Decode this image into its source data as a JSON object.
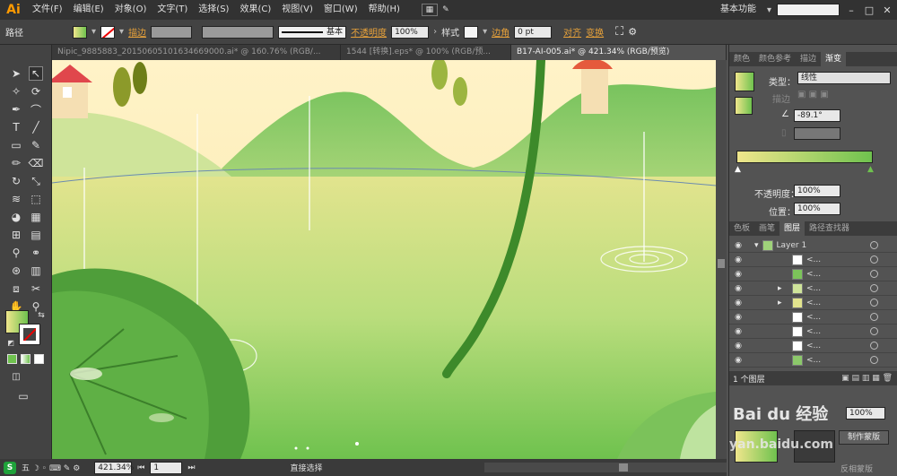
{
  "app": {
    "logo": "Ai"
  },
  "menubar": {
    "items": [
      "文件(F)",
      "编辑(E)",
      "对象(O)",
      "文字(T)",
      "选择(S)",
      "效果(C)",
      "视图(V)",
      "窗口(W)",
      "帮助(H)"
    ],
    "workspace": "基本功能",
    "window_controls": [
      "–",
      "□",
      "✕"
    ]
  },
  "control_bar": {
    "selection_label": "路径",
    "stroke_label": "描边",
    "stroke_style": "基本",
    "opacity_label": "不透明度",
    "opacity_value": "100%",
    "style_label": "样式",
    "corner_label": "边角",
    "corner_value": "0 pt",
    "align_label": "对齐",
    "transform_label": "变换"
  },
  "tabs": [
    {
      "label": "Nipic_9885883_20150605101634669000.ai* @ 160.76% (RGB/...",
      "active": false
    },
    {
      "label": "1544 [转换].eps* @ 100% (RGB/预...",
      "active": false
    },
    {
      "label": "B17-AI-005.ai* @ 421.34% (RGB/预览)",
      "active": true
    }
  ],
  "gradient_panel": {
    "tabs": [
      "颜色",
      "颜色参考",
      "描边",
      "渐变"
    ],
    "active_tab": "渐变",
    "type_label": "类型：",
    "type_value": "线性",
    "stroke_label": "描边",
    "angle_value": "-89.1°",
    "opacity_label": "不透明度：",
    "opacity_value": "100%",
    "location_label": "位置：",
    "location_value": "100%",
    "start_color": "#f0e68c",
    "end_color": "#6fc24e"
  },
  "layers_panel": {
    "tabs": [
      "色板",
      "画笔",
      "图层",
      "路径查找器"
    ],
    "active_tab": "图层",
    "layer_name": "Layer 1",
    "sublayer_names": [
      "<...",
      "<...",
      "<...",
      "<...",
      "<...",
      "<...",
      "<...",
      "<..."
    ],
    "footer": "1 个图层"
  },
  "bottom_panel": {
    "opacity_value": "100%",
    "make_mask": "制作蒙版",
    "invert_mask": "反相蒙版",
    "watermark": "Bai du 经验",
    "watermark_url": "yan.baidu.com"
  },
  "statusbar": {
    "zoom": "421.34%",
    "page": "1",
    "tool": "直接选择"
  },
  "colors": {
    "accent": "#e8a23a",
    "panel": "#535353",
    "dark": "#323232"
  }
}
